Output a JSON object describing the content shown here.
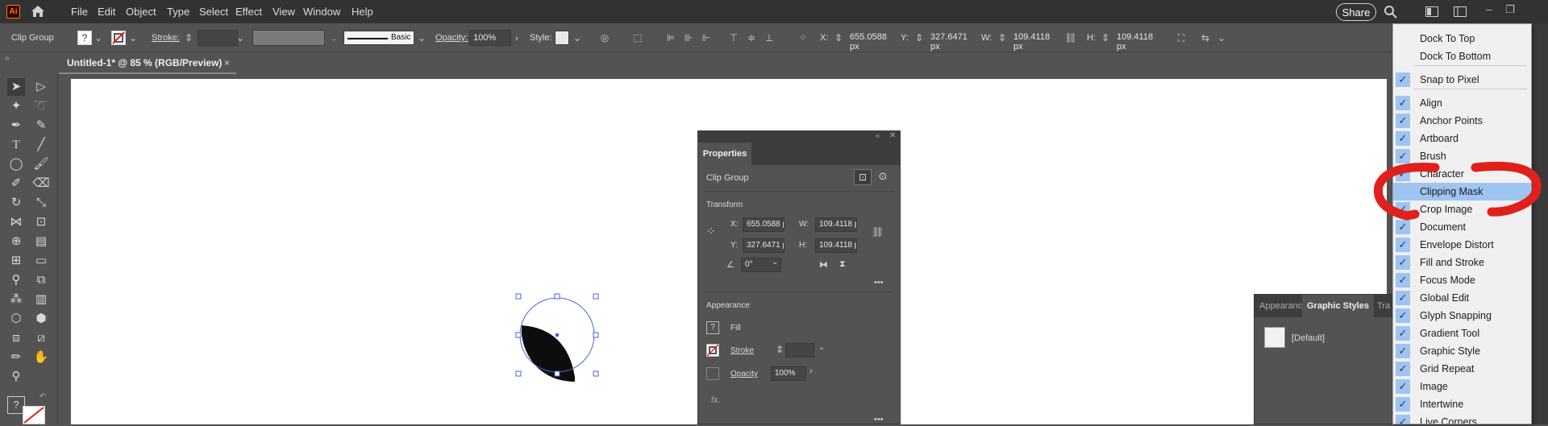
{
  "menubar": {
    "logo": "Ai",
    "items": [
      "File",
      "Edit",
      "Object",
      "Type",
      "Select",
      "Effect",
      "View",
      "Window",
      "Help"
    ],
    "share_label": "Share"
  },
  "controlbar": {
    "selection_label": "Clip Group",
    "stroke_label": "Stroke:",
    "brush_label": "Basic",
    "opacity_label": "Opacity:",
    "opacity_value": "100%",
    "style_label": "Style:",
    "x_label": "X:",
    "x_value": "655.0588 px",
    "y_label": "Y:",
    "y_value": "327.6471 px",
    "w_label": "W:",
    "w_value": "109.4118 px",
    "h_label": "H:",
    "h_value": "109.4118 px"
  },
  "document": {
    "tab_title": "Untitled-1* @ 85 % (RGB/Preview)",
    "close_glyph": "×"
  },
  "properties_panel": {
    "tab_label": "Properties",
    "selection_type": "Clip Group",
    "transform_heading": "Transform",
    "x_label": "X:",
    "x_value": "655.0588 p",
    "y_label": "Y:",
    "y_value": "327.6471 p",
    "w_label": "W:",
    "w_value": "109.4118 p",
    "h_label": "H:",
    "h_value": "109.4118 p",
    "angle_value": "0°",
    "appearance_heading": "Appearance",
    "fill_label": "Fill",
    "stroke_label": "Stroke",
    "opacity_label": "Opacity",
    "opacity_value": "100%",
    "fx_label": "fx."
  },
  "graphic_styles_panel": {
    "tabs": [
      "Appearanc",
      "Graphic Styles",
      "Tra"
    ],
    "default_style_label": "[Default]"
  },
  "window_menu": {
    "items": [
      {
        "label": "Dock To Top",
        "checked": false
      },
      {
        "label": "Dock To Bottom",
        "checked": false
      },
      {
        "label": "Snap to Pixel",
        "checked": true
      },
      {
        "label": "Align",
        "checked": true
      },
      {
        "label": "Anchor Points",
        "checked": true
      },
      {
        "label": "Artboard",
        "checked": true
      },
      {
        "label": "Brush",
        "checked": true
      },
      {
        "label": "Character",
        "checked": true
      },
      {
        "label": "Clipping Mask",
        "checked": false,
        "highlighted": true
      },
      {
        "label": "Crop Image",
        "checked": true
      },
      {
        "label": "Document",
        "checked": true
      },
      {
        "label": "Envelope Distort",
        "checked": true
      },
      {
        "label": "Fill and Stroke",
        "checked": true
      },
      {
        "label": "Focus Mode",
        "checked": true
      },
      {
        "label": "Global Edit",
        "checked": true
      },
      {
        "label": "Glyph Snapping",
        "checked": true
      },
      {
        "label": "Gradient Tool",
        "checked": true
      },
      {
        "label": "Graphic Style",
        "checked": true
      },
      {
        "label": "Grid Repeat",
        "checked": true
      },
      {
        "label": "Image",
        "checked": true
      },
      {
        "label": "Intertwine",
        "checked": true
      },
      {
        "label": "Live Corners",
        "checked": true
      }
    ]
  },
  "colors": {
    "app_bg": "#535353",
    "menubar_bg": "#323232",
    "menu_highlight": "#9ec4f1",
    "annotation_red": "#e0201c",
    "selection_blue": "#4a64d8"
  }
}
